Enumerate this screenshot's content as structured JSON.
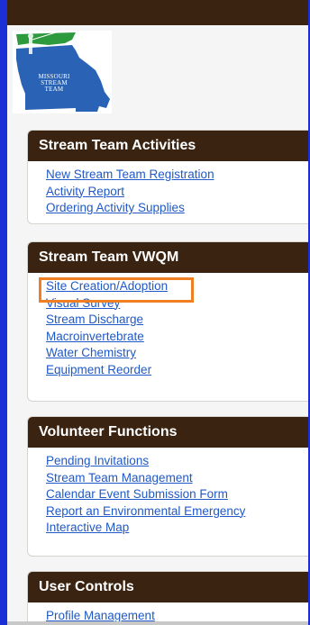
{
  "logo": {
    "line1": "MISSOURI",
    "line2": "STREAM",
    "line3": "TEAM",
    "colors": {
      "state_blue": "#2a63b5",
      "accent_green": "#2d9a3e",
      "bg": "#ffffff"
    }
  },
  "panels": [
    {
      "title": "Stream Team Activities",
      "links": [
        "New Stream Team Registration",
        "Activity Report",
        "Ordering Activity Supplies"
      ]
    },
    {
      "title": "Stream Team VWQM",
      "links": [
        "Site Creation/Adoption",
        "Visual Survey",
        "Stream Discharge",
        "Macroinvertebrate",
        "Water Chemistry",
        "Equipment Reorder"
      ]
    },
    {
      "title": "Volunteer Functions",
      "links": [
        "Pending Invitations",
        "Stream Team Management",
        "Calendar Event Submission Form",
        "Report an Environmental Emergency",
        "Interactive Map"
      ]
    },
    {
      "title": "User Controls",
      "links": [
        "Profile Management"
      ]
    }
  ],
  "theme": {
    "header_bg": "#3a2310",
    "link_color": "#1f59c7",
    "highlight_color": "#f07e22",
    "frame_border": "#1a2fd6"
  }
}
